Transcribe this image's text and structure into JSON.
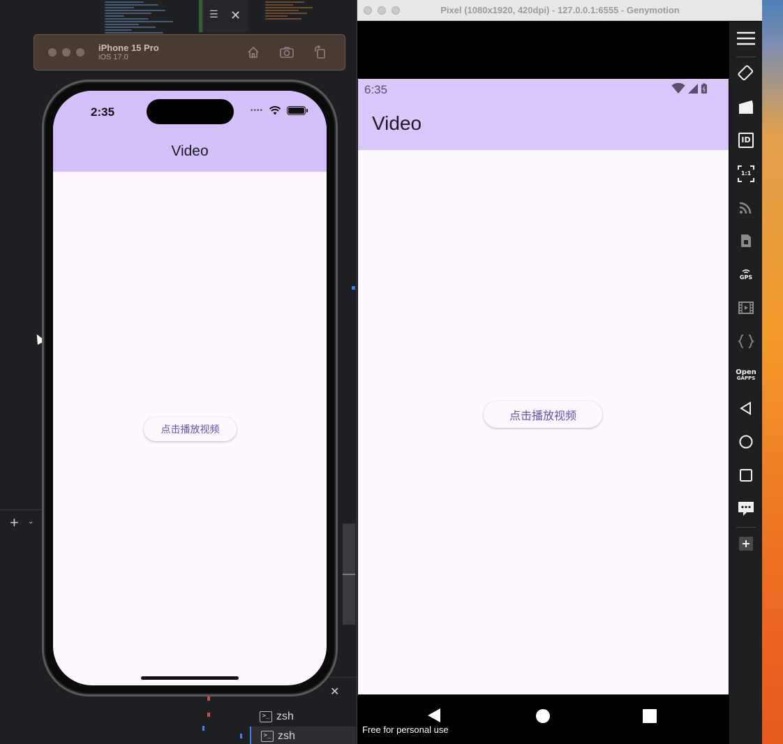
{
  "editor": {
    "add_symbol": "+",
    "close_symbol": "✕",
    "terminals": [
      {
        "label": "zsh"
      },
      {
        "label": "zsh"
      }
    ]
  },
  "ios_simulator": {
    "device_name": "iPhone 15 Pro",
    "os_version": "iOS 17.0",
    "toolbar_icons": [
      "home-icon",
      "screenshot-icon",
      "rotate-icon"
    ],
    "screen": {
      "status_time": "2:35",
      "app_title": "Video",
      "play_button_label": "点击播放视频"
    },
    "colors": {
      "header": "#d3c0f8",
      "background": "#fdf7ff",
      "accent": "#6750a4"
    }
  },
  "genymotion": {
    "window_title": "Pixel (1080x1920, 420dpi) - 127.0.0.1:6555 - Genymotion",
    "screen": {
      "status_time": "6:35",
      "app_title": "Video",
      "play_button_label": "点击播放视频",
      "watermark": "Free for personal use"
    },
    "colors": {
      "appbar": "#d9c6fb",
      "background": "#fdf7ff",
      "accent": "#6750a4"
    },
    "sidebar": {
      "gps_label": "GPS",
      "open_gapps_label": [
        "Open",
        "GAPPS"
      ],
      "fit_label": "1:1",
      "id_label": "ID",
      "icons": [
        "menu-icon",
        "rotate-icon",
        "camera-icon",
        "identifiers-icon",
        "pixel-perfect-icon",
        "network-icon",
        "sim-icon",
        "gps-icon",
        "capture-icon",
        "javascript-icon",
        "open-gapps-icon",
        "back-icon",
        "home-icon",
        "recent-apps-icon",
        "more-icon",
        "add-icon"
      ]
    }
  }
}
